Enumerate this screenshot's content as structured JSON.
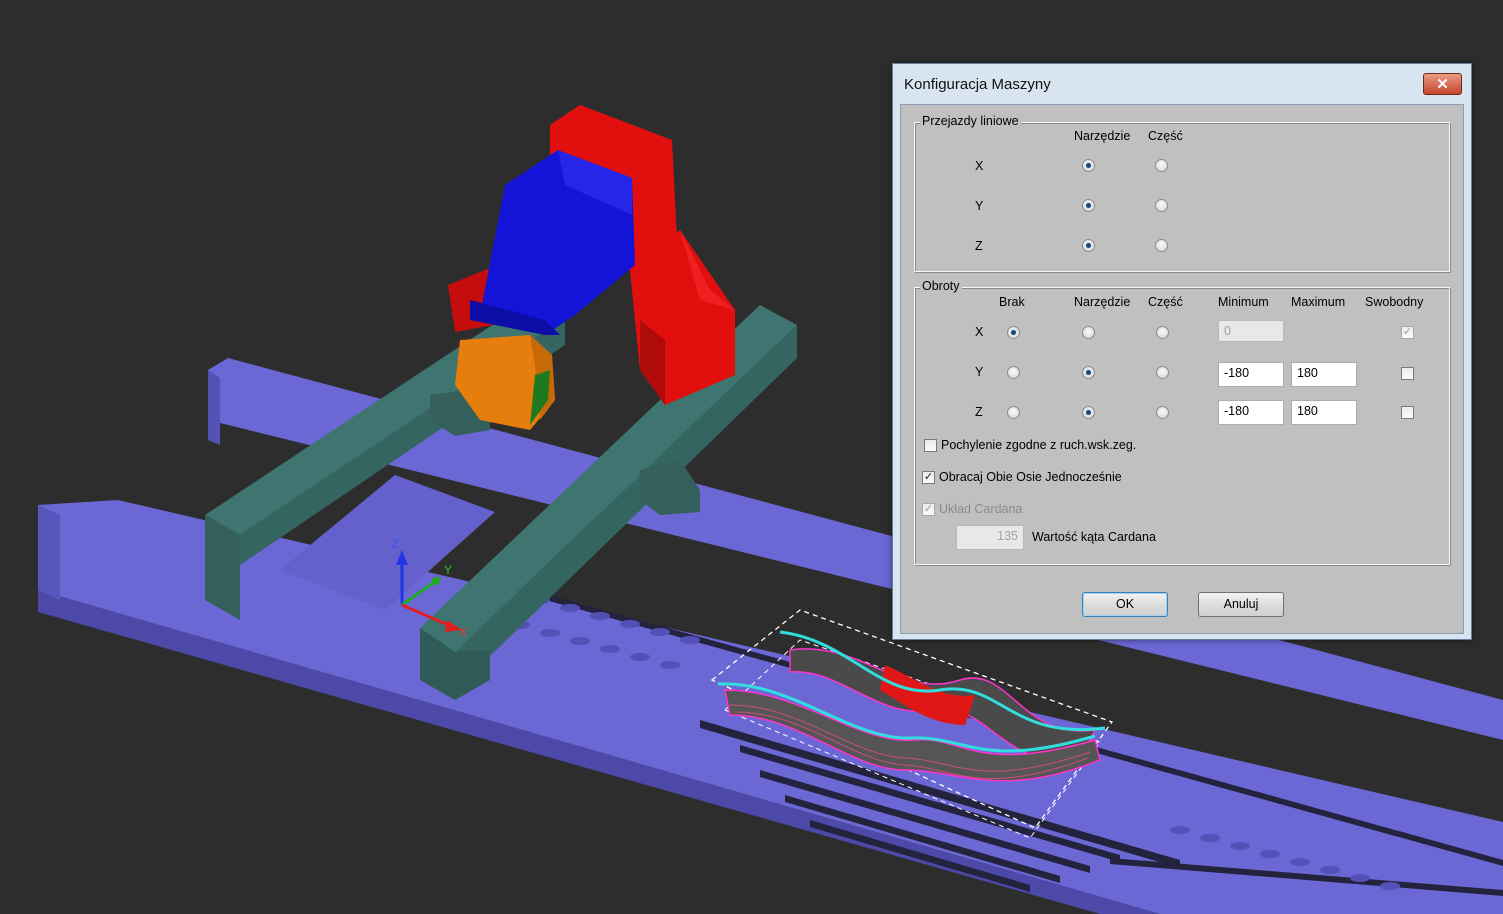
{
  "dialog": {
    "title": "Konfiguracja Maszyny",
    "close_icon": "close-icon"
  },
  "linear": {
    "legend": "Przejazdy liniowe",
    "col_tool": "Narzędzie",
    "col_part": "Część",
    "rows": [
      {
        "axis": "X",
        "selected": "tool"
      },
      {
        "axis": "Y",
        "selected": "tool"
      },
      {
        "axis": "Z",
        "selected": "tool"
      }
    ]
  },
  "rotations": {
    "legend": "Obroty",
    "col_none": "Brak",
    "col_tool": "Narzędzie",
    "col_part": "Część",
    "col_min": "Minimum",
    "col_max": "Maximum",
    "col_free": "Swobodny",
    "rows": [
      {
        "axis": "X",
        "selected": "none",
        "min": "0",
        "max": "",
        "free": true
      },
      {
        "axis": "Y",
        "selected": "tool",
        "min": "-180",
        "max": "180",
        "free": false
      },
      {
        "axis": "Z",
        "selected": "tool",
        "min": "-180",
        "max": "180",
        "free": false
      }
    ]
  },
  "options": {
    "tilt_clockwise_label": "Pochylenie zgodne z ruch.wsk.zeg.",
    "tilt_clockwise_checked": false,
    "rotate_both_label": "Obracaj Obie Osie Jednocześnie",
    "rotate_both_checked": true,
    "cardan_label": "Układ Cardana",
    "cardan_checked": true,
    "cardan_angle_value": "135",
    "cardan_angle_label": "Wartość kąta Cardana"
  },
  "buttons": {
    "ok": "OK",
    "cancel": "Anuluj"
  },
  "scene": {
    "axis_x": "X",
    "axis_y": "Y",
    "axis_z": "Z",
    "colors": {
      "background": "#2d2d2d",
      "bed": "#6b68d6",
      "gantry": "#3a6b66",
      "head_red": "#e20f0f",
      "head_blue": "#1414d8",
      "spindle_orange": "#e57e0c"
    }
  }
}
